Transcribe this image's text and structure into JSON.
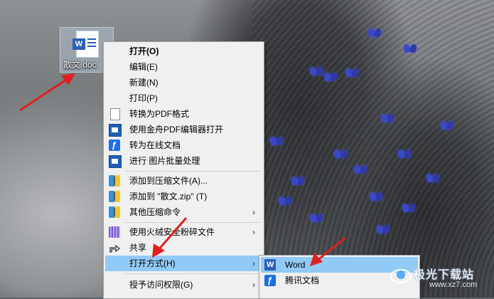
{
  "desktop": {
    "file_icon": {
      "label": "散文.doc"
    }
  },
  "context_menu": {
    "items": [
      {
        "label": "打开(O)",
        "bold": true,
        "icon": "none"
      },
      {
        "label": "编辑(E)",
        "icon": "none"
      },
      {
        "label": "新建(N)",
        "icon": "none"
      },
      {
        "label": "打印(P)",
        "icon": "none"
      },
      {
        "label": "转换为PDF格式",
        "icon": "document-icon"
      },
      {
        "label": "使用金舟PDF编辑器打开",
        "icon": "pdf-editor-icon"
      },
      {
        "label": "转为在线文档",
        "icon": "tencent-docs-icon"
      },
      {
        "label": "进行 图片批量处理",
        "icon": "image-batch-icon"
      },
      {
        "label": "添加到压缩文件(A)...",
        "icon": "archive-icon"
      },
      {
        "label": "添加到 \"散文.zip\" (T)",
        "icon": "archive-icon"
      },
      {
        "label": "其他压缩命令",
        "icon": "archive-icon",
        "submenu": true
      },
      {
        "label": "使用火绒安全粉碎文件",
        "icon": "shredder-icon",
        "submenu": true
      },
      {
        "label": "共享",
        "icon": "share-icon"
      },
      {
        "label": "打开方式(H)",
        "icon": "none",
        "submenu": true,
        "highlighted": true
      },
      {
        "label": "授予访问权限(G)",
        "icon": "none",
        "submenu": true
      }
    ]
  },
  "open_with_submenu": {
    "items": [
      {
        "label": "Word",
        "icon": "word-icon",
        "highlighted": true
      },
      {
        "label": "腾讯文档",
        "icon": "tencent-docs-icon"
      }
    ]
  },
  "watermark": {
    "text": "极光下载站",
    "url": "www.xz7.com"
  },
  "colors": {
    "menu_bg": "#f0f0f0",
    "highlight": "#91c9f7",
    "arrow_red": "#e02020"
  }
}
